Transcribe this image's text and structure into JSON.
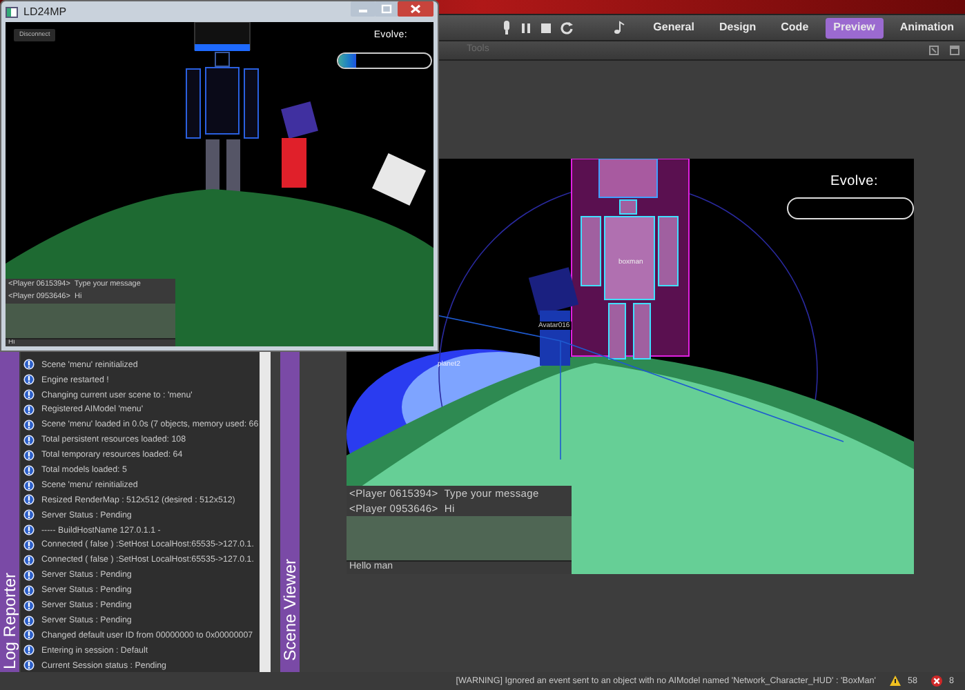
{
  "toolbar": {
    "tabs": [
      {
        "label": "General",
        "selected": false
      },
      {
        "label": "Design",
        "selected": false
      },
      {
        "label": "Code",
        "selected": false
      },
      {
        "label": "Preview",
        "selected": true
      },
      {
        "label": "Animation",
        "selected": false
      }
    ]
  },
  "sub_toolbar": {
    "label": "Tools"
  },
  "game_window": {
    "title": "LD24MP",
    "disconnect_button": "Disconnect",
    "evolve_label": "Evolve:",
    "evolve_meter": {
      "level": 0.2
    },
    "chat": {
      "messages": [
        "<Player 0615394>  Type your message",
        "<Player 0953646>  Hi"
      ],
      "input_value": "Hi"
    }
  },
  "log_reporter": {
    "tab_label": "Log Reporter",
    "entries": [
      "Scene 'menu' reinitialized",
      "Engine restarted !",
      "Changing current user scene to : 'menu'",
      "Registered AIModel 'menu'",
      "Scene 'menu' loaded in 0.0s (7 objects, memory used: 66",
      "Total persistent resources loaded: 108",
      "Total temporary  resources loaded: 64",
      "Total models loaded: 5",
      "Scene 'menu' reinitialized",
      "Resized RenderMap : 512x512 (desired : 512x512)",
      "Server Status : Pending",
      "----- BuildHostName 127.0.1.1 -",
      "Connected ( false ) :SetHost LocalHost:65535->127.0.1.",
      "Connected ( false ) :SetHost LocalHost:65535->127.0.1.",
      "Server Status : Pending",
      "Server Status : Pending",
      "Server Status : Pending",
      "Server Status : Pending",
      "Changed default user ID from 00000000 to 0x00000007",
      "Entering in session : Default",
      "Current Session status : Pending"
    ]
  },
  "scene_viewer": {
    "tab_label": "Scene Viewer",
    "object_labels": [
      "boxman",
      "Avatar016",
      "planet2"
    ],
    "evolve_label": "Evolve:",
    "evolve_meter": {
      "level": 0
    },
    "chat": {
      "messages": [
        "<Player 0615394>  Type your message",
        "<Player 0953646>  Hi"
      ],
      "input_value": "Hello man"
    }
  },
  "status_bar": {
    "message": "[WARNING] Ignored an event sent to an object with no AIModel named 'Network_Character_HUD' : 'BoxMan'",
    "warnings": "58",
    "errors": "8"
  }
}
